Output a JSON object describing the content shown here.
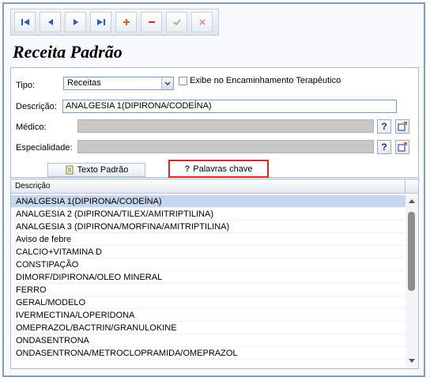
{
  "colors": {
    "nav_blue": "#2a58c7",
    "plus_red": "#e05a1a",
    "minus_red": "#d8261c",
    "check_green": "#7fb56a",
    "cancel_red": "#e58a80",
    "highlight_border": "#e2261f",
    "selected_row": "#c5d6ee"
  },
  "toolbar": {
    "buttons": [
      {
        "name": "first-record-button",
        "icon": "skip-first-icon"
      },
      {
        "name": "previous-record-button",
        "icon": "triangle-left-icon"
      },
      {
        "name": "next-record-button",
        "icon": "triangle-right-icon"
      },
      {
        "name": "last-record-button",
        "icon": "skip-last-icon"
      },
      {
        "name": "add-record-button",
        "icon": "plus-icon"
      },
      {
        "name": "delete-record-button",
        "icon": "minus-icon"
      },
      {
        "name": "confirm-button",
        "icon": "check-icon"
      },
      {
        "name": "cancel-button",
        "icon": "x-icon"
      }
    ]
  },
  "title": "Receita Padrão",
  "form": {
    "tipo_label": "Tipo:",
    "tipo_value": "Receitas",
    "exibe_label": "Exibe no Encaminhamento Terapêutico",
    "exibe_checked": false,
    "descricao_label": "Descrição:",
    "descricao_value": "ANALGESIA 1(DIPIRONA/CODEÍNA)",
    "medico_label": "Médico:",
    "medico_value": "",
    "especialidade_label": "Especialidade:",
    "especialidade_value": "",
    "help_glyph": "?",
    "texto_padrao_label": "Texto Padrão",
    "palavras_chave_label": "Palavras chave"
  },
  "grid": {
    "header": "Descrição",
    "rows": [
      "ANALGESIA 1(DIPIRONA/CODEÍNA)",
      "ANALGESIA 2 (DIPIRONA/TILEX/AMITRIPTILINA)",
      "ANALGESIA 3 (DIPIRONA/MORFINA/AMITRIPTILINA)",
      "Aviso de febre",
      "CALCIO+VITAMINA D",
      "CONSTIPAÇÃO",
      "DIMORF/DIPIRONA/OLEO MINERAL",
      "FERRO",
      "GERAL/MODELO",
      "IVERMECTINA/LOPERIDONA",
      "OMEPRAZOL/BACTRIN/GRANULOKINE",
      "ONDASENTRONA",
      "ONDASENTRONA/METROCLOPRAMIDA/OMEPRAZOL"
    ],
    "selected_index": 0
  }
}
